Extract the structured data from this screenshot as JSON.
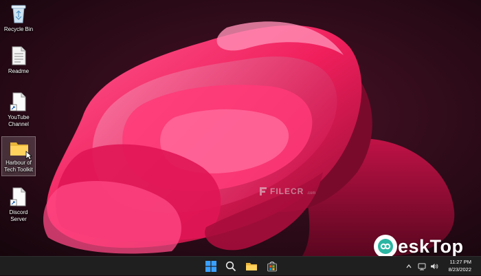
{
  "desktop": {
    "icons": [
      {
        "name": "Recycle Bin",
        "label": "Recycle Bin"
      },
      {
        "name": "Readme",
        "label": "Readme"
      },
      {
        "name": "YouTube Channel",
        "label_line1": "YouTube",
        "label_line2": "Channel"
      },
      {
        "name": "Harbour of Tech Toolkit",
        "label_line1": "Harbour of",
        "label_line2": "Tech Toolkit",
        "selected": true
      },
      {
        "name": "Discord Server",
        "label_line1": "Discord",
        "label_line2": "Server"
      }
    ]
  },
  "watermark": {
    "text": "FILECR",
    "suffix": ".com"
  },
  "brand": {
    "text": "eskTop"
  },
  "taskbar": {
    "apps": [
      "start-icon",
      "search-icon",
      "file-explorer-icon",
      "store-icon"
    ],
    "tray": [
      "chevron-up-icon",
      "network-icon",
      "speaker-icon"
    ],
    "clock": {
      "time": "11:27 PM",
      "date": "8/23/2022"
    }
  },
  "colors": {
    "accent": "#ff2d6b",
    "taskbar": "#1f1f1f",
    "wallpaper_bg": "#1a0710"
  }
}
